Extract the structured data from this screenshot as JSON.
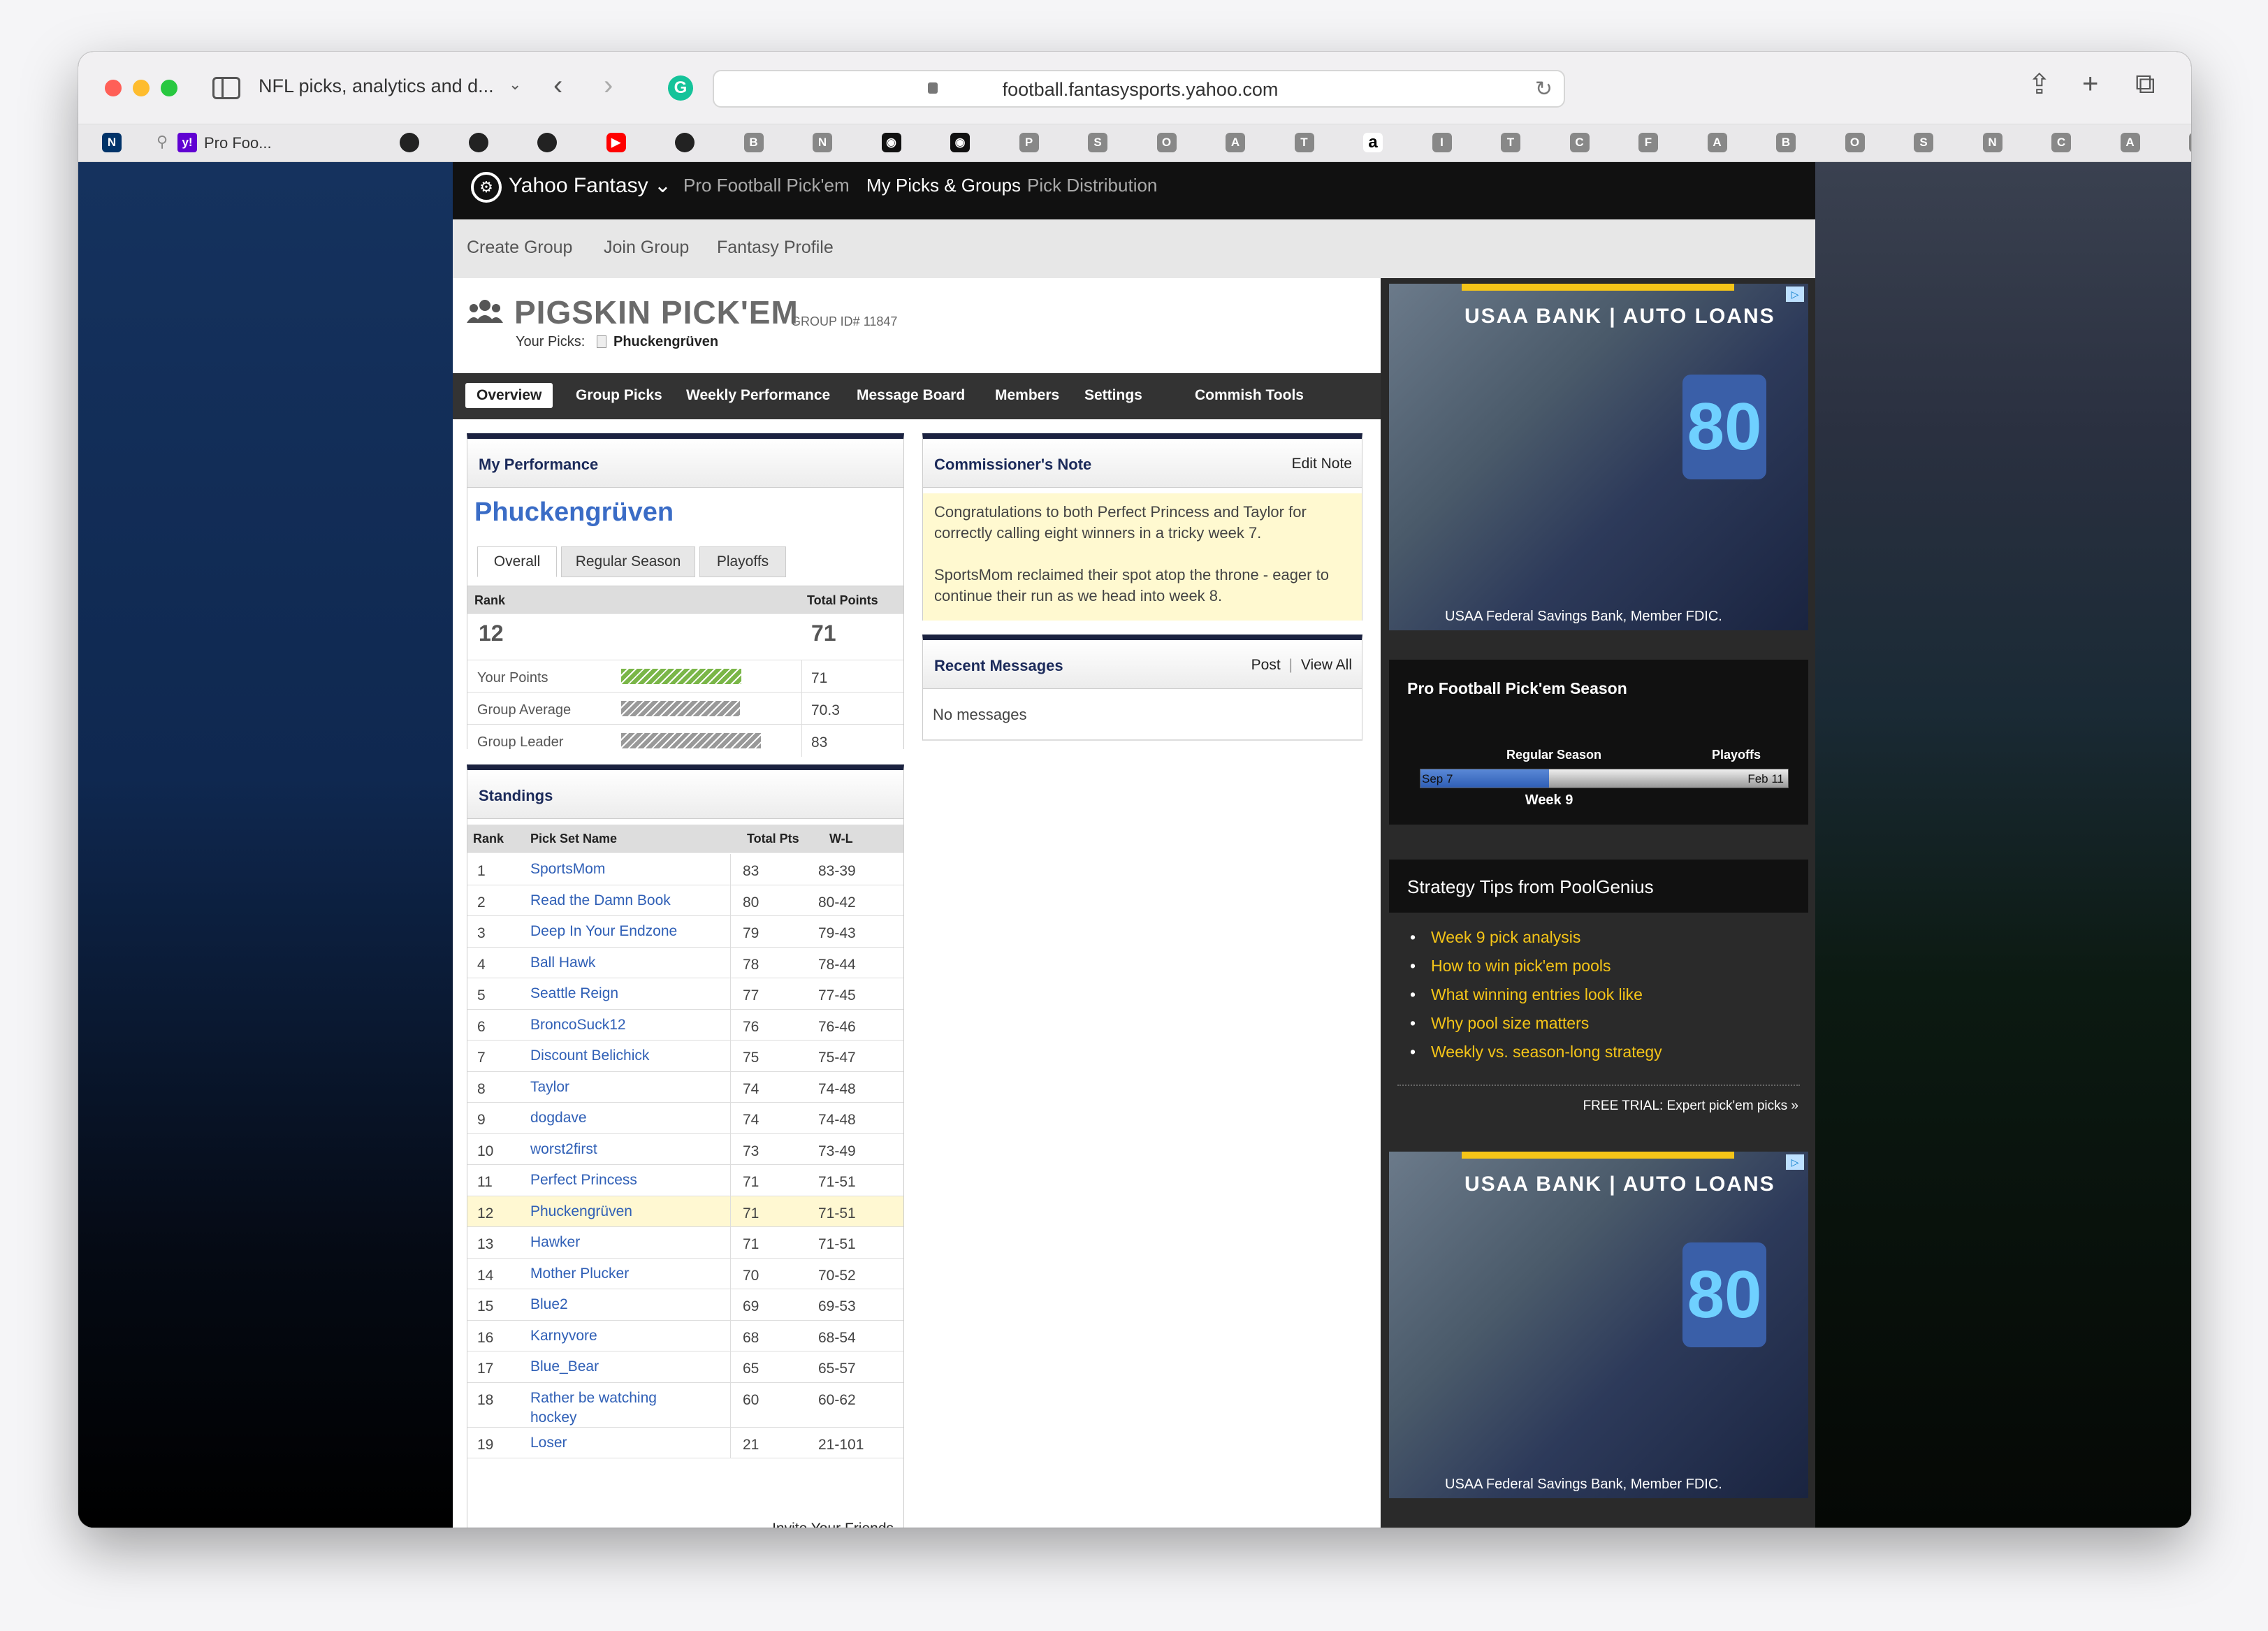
{
  "browser": {
    "tab_title": "NFL picks, analytics and d...",
    "url": "football.fantasysports.yahoo.com",
    "pinned_tab_label": "Pro Foo...",
    "favorites": [
      "nfl",
      "pin",
      "yahoo",
      "github",
      "github",
      "github",
      "youtube",
      "github",
      "B",
      "N",
      "camera",
      "camera",
      "P",
      "S",
      "O",
      "A",
      "T",
      "a",
      "I",
      "T",
      "C",
      "F",
      "A",
      "B",
      "O",
      "S",
      "N",
      "C",
      "A",
      "S"
    ]
  },
  "yahoo": {
    "brand": "Yahoo Fantasy",
    "top_links": [
      "Pro Football Pick'em",
      "My Picks & Groups",
      "Pick Distribution"
    ],
    "sub_nav": [
      "Create Group",
      "Join Group",
      "Fantasy Profile"
    ]
  },
  "group": {
    "title": "PIGSKIN PICK'EM",
    "group_id": "GROUP ID# 11847",
    "your_picks_label": "Your Picks:",
    "your_picks_name": "Phuckengrüven",
    "nav": [
      "Overview",
      "Group Picks",
      "Weekly Performance",
      "Message Board",
      "Members",
      "Settings",
      "Commish Tools"
    ]
  },
  "performance": {
    "title": "My Performance",
    "team_name": "Phuckengrüven",
    "tabs": [
      "Overall",
      "Regular Season",
      "Playoffs"
    ],
    "rank_header": "Rank",
    "total_header": "Total Points",
    "rank": "12",
    "total": "71",
    "rows": [
      {
        "label": "Your Points",
        "value": "71",
        "fraction": 0.86,
        "color": "#7ab648"
      },
      {
        "label": "Group Average",
        "value": "70.3",
        "fraction": 0.85,
        "color": "#999999"
      },
      {
        "label": "Group Leader",
        "value": "83",
        "fraction": 1.0,
        "color": "#999999"
      }
    ]
  },
  "standings": {
    "title": "Standings",
    "headers": [
      "Rank",
      "Pick Set Name",
      "Total Pts",
      "W-L"
    ],
    "rows": [
      [
        "1",
        "SportsMom",
        "83",
        "83-39"
      ],
      [
        "2",
        "Read the Damn Book",
        "80",
        "80-42"
      ],
      [
        "3",
        "Deep In Your Endzone",
        "79",
        "79-43"
      ],
      [
        "4",
        "Ball Hawk",
        "78",
        "78-44"
      ],
      [
        "5",
        "Seattle Reign",
        "77",
        "77-45"
      ],
      [
        "6",
        "BroncoSuck12",
        "76",
        "76-46"
      ],
      [
        "7",
        "Discount Belichick",
        "75",
        "75-47"
      ],
      [
        "8",
        "Taylor",
        "74",
        "74-48"
      ],
      [
        "9",
        "dogdave",
        "74",
        "74-48"
      ],
      [
        "10",
        "worst2first",
        "73",
        "73-49"
      ],
      [
        "11",
        "Perfect Princess",
        "71",
        "71-51"
      ],
      [
        "12",
        "Phuckengrüven",
        "71",
        "71-51"
      ],
      [
        "13",
        "Hawker",
        "71",
        "71-51"
      ],
      [
        "14",
        "Mother Plucker",
        "70",
        "70-52"
      ],
      [
        "15",
        "Blue2",
        "69",
        "69-53"
      ],
      [
        "16",
        "Karnyvore",
        "68",
        "68-54"
      ],
      [
        "17",
        "Blue_Bear",
        "65",
        "65-57"
      ],
      [
        "18",
        "Rather be watching hockey",
        "60",
        "60-62"
      ],
      [
        "19",
        "Loser",
        "21",
        "21-101"
      ]
    ],
    "highlight_rank": "12",
    "invite": "Invite Your Friends"
  },
  "note": {
    "title": "Commissioner's Note",
    "edit": "Edit Note",
    "p1": "Congratulations to both Perfect Princess and Taylor for correctly calling eight winners in a tricky week 7.",
    "p2": "SportsMom reclaimed their spot atop the throne - eager to continue their run as we head into week 8."
  },
  "messages": {
    "title": "Recent Messages",
    "post": "Post",
    "sep": "|",
    "view_all": "View All",
    "empty": "No messages"
  },
  "ad": {
    "title": "USAA BANK | AUTO LOANS",
    "jersey": "80",
    "footer": "USAA Federal Savings Bank, Member FDIC.",
    "choice": "▷"
  },
  "season": {
    "title": "Pro Football Pick'em Season",
    "regular": "Regular Season",
    "playoffs": "Playoffs",
    "start": "Sep 7",
    "end": "Feb 11",
    "current": "Week 9",
    "progress": 0.35
  },
  "tips": {
    "title": "Strategy Tips from PoolGenius",
    "items": [
      "Week 9 pick analysis",
      "How to win pick'em pools",
      "What winning entries look like",
      "Why pool size matters",
      "Weekly vs. season-long strategy"
    ],
    "cta": "FREE TRIAL: Expert pick'em picks »"
  }
}
